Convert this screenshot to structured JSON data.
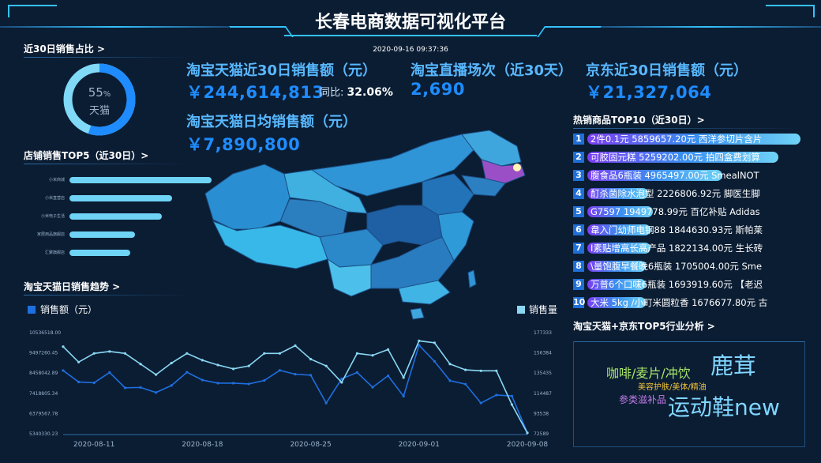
{
  "header": {
    "title": "长春电商数据可视化平台",
    "datetime": "2020-09-16 09:37:36"
  },
  "colors": {
    "background": "#0b1d33",
    "accent": "#1e8cff",
    "highlight": "#58b8ff",
    "gauge": "#1e8cff"
  },
  "sales_share": {
    "title": "近30日销售占比 >",
    "percent": 55,
    "percent_text": "55",
    "percent_sign": "%",
    "label": "天猫"
  },
  "shop_top5": {
    "title": "店铺销售TOP5（近30日）>",
    "shops": [
      {
        "name": "小米商城",
        "value": 1.0
      },
      {
        "name": "小米直营店",
        "value": 0.72
      },
      {
        "name": "小米电子生活",
        "value": 0.65
      },
      {
        "name": "家居用品旗舰店",
        "value": 0.46
      },
      {
        "name": "汇聚旗舰店",
        "value": 0.43
      }
    ]
  },
  "kpis": {
    "taobao_30d": {
      "label": "淘宝天猫近30日销售额（元）",
      "value": "￥244,614,813",
      "yoy_label": "同比:",
      "yoy_value": "32.06%"
    },
    "live_30d": {
      "label": "淘宝直播场次（近30天）",
      "value": "2,690"
    },
    "jd_30d": {
      "label": "京东近30日销售额（元）",
      "value": "￥21,327,064"
    },
    "taobao_daily": {
      "label": "淘宝天猫日均销售额（元）",
      "value": "￥7,890,800"
    }
  },
  "map": {
    "highlighted_region": "吉林",
    "icon": "china-map"
  },
  "hot_products": {
    "title": "热销商品TOP10（近30日）>",
    "items": [
      {
        "rank": "1",
        "text": "2件0.1元 5859657.20元   西洋参切片含片",
        "bar": 0.98
      },
      {
        "rank": "2",
        "text": "可胶固元糕 5259202.00元   拍四盒费划算",
        "bar": 0.88
      },
      {
        "rank": "3",
        "text": "腹食品6瓶装 4965497.00元   SmealNOT",
        "bar": 0.62
      },
      {
        "rank": "4",
        "text": "酊杀菌除水泡型 2226806.92元   脚医生脚",
        "bar": 0.28
      },
      {
        "rank": "5",
        "text": "G7597 1949778.99元   百亿补贴 Adidas",
        "bar": 0.3
      },
      {
        "rank": "6",
        "text": "韋入门幼师电钢88 1844630.93元   斯帕莱",
        "bar": 0.29
      },
      {
        "rank": "7",
        "text": "I素贴增高长高产品 1822134.00元   生长砖",
        "bar": 0.29
      },
      {
        "rank": "8",
        "text": "\\量饱腹早餐晚6瓶装 1705004.00元   Sme",
        "bar": 0.27
      },
      {
        "rank": "9",
        "text": "万普6个口味6瓶装 1693919.60元   【老迟",
        "bar": 0.27
      },
      {
        "rank": "10",
        "text": "大米 5kg /小町米圆粒香 1676677.80元   古",
        "bar": 0.27
      }
    ]
  },
  "industry": {
    "title": "淘宝天猫+京东TOP5行业分析 >",
    "words": [
      {
        "text": "鹿茸",
        "color": "#7fd6ff"
      },
      {
        "text": "咖啡/麦片/冲饮",
        "color": "#a8e66a"
      },
      {
        "text": "美容护肤/美体/精油",
        "color": "#f0c23a"
      },
      {
        "text": "参类滋补品",
        "color": "#c27be8"
      },
      {
        "text": "运动鞋new",
        "color": "#7fd6ff"
      }
    ]
  },
  "trend": {
    "title": "淘宝天猫日销售趋势 >",
    "legend_left": "销售额（元）",
    "legend_right": "销售量"
  },
  "chart_data": {
    "type": "line",
    "title": "淘宝天猫日销售趋势",
    "x": [
      "2020-08-09",
      "2020-08-10",
      "2020-08-11",
      "2020-08-12",
      "2020-08-13",
      "2020-08-14",
      "2020-08-15",
      "2020-08-16",
      "2020-08-17",
      "2020-08-18",
      "2020-08-19",
      "2020-08-20",
      "2020-08-21",
      "2020-08-22",
      "2020-08-23",
      "2020-08-24",
      "2020-08-25",
      "2020-08-26",
      "2020-08-27",
      "2020-08-28",
      "2020-08-29",
      "2020-08-30",
      "2020-08-31",
      "2020-09-01",
      "2020-09-02",
      "2020-09-03",
      "2020-09-04",
      "2020-09-05",
      "2020-09-06",
      "2020-09-07",
      "2020-09-08"
    ],
    "x_ticks": [
      "2020-08-11",
      "2020-08-18",
      "2020-08-25",
      "2020-09-01",
      "2020-09-08"
    ],
    "y_left_ticks": [
      "10536518.00",
      "9497260.45",
      "8458042.89",
      "7418805.34",
      "6379567.78",
      "5340330.23"
    ],
    "y_right_ticks": [
      "177333",
      "156384",
      "135435",
      "114487",
      "93538",
      "72589"
    ],
    "ylim_left": [
      5340330.23,
      10536518.0
    ],
    "ylim_right": [
      72589,
      177333
    ],
    "series": [
      {
        "name": "销售额（元）",
        "axis": "left",
        "color": "#1e6fe0",
        "values": [
          8550000,
          7960000,
          7920000,
          8450000,
          7660000,
          7680000,
          7420000,
          7780000,
          8460000,
          8060000,
          7900000,
          7900000,
          7860000,
          8040000,
          8560000,
          8360000,
          8310000,
          6880000,
          8120000,
          8450000,
          7690000,
          8280000,
          7230000,
          9850000,
          9020000,
          8030000,
          7850000,
          6880000,
          7290000,
          7240000,
          5360000
        ]
      },
      {
        "name": "销售量",
        "axis": "right",
        "color": "#8ad8f4",
        "values": [
          162000,
          146000,
          155000,
          157000,
          155000,
          144000,
          133000,
          145000,
          155000,
          148000,
          143000,
          139000,
          142000,
          155000,
          155000,
          163000,
          149000,
          142000,
          125000,
          155000,
          153000,
          159000,
          130000,
          168000,
          166000,
          144000,
          138000,
          137000,
          137000,
          102000,
          72600
        ]
      }
    ],
    "grid": false,
    "legend": "top"
  }
}
